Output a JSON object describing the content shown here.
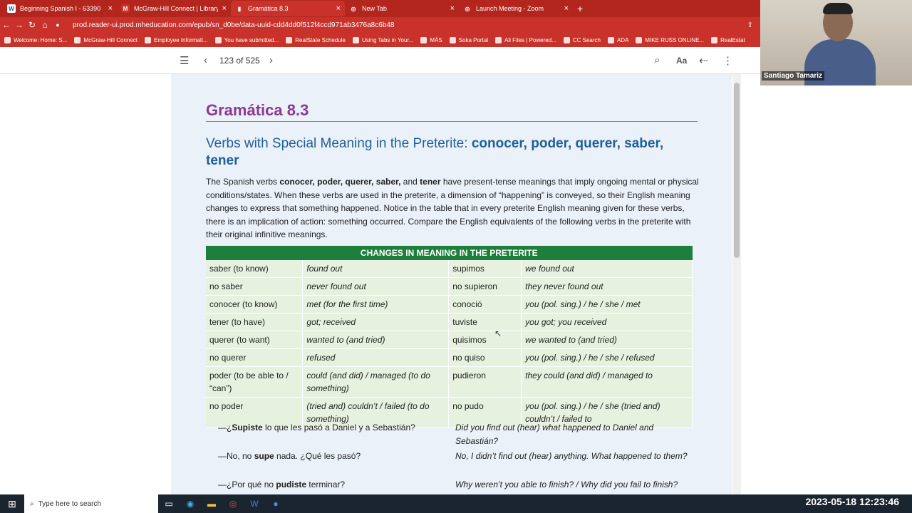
{
  "browser": {
    "tabs": [
      {
        "label": "Beginning Spanish I - 63390",
        "fav": "W"
      },
      {
        "label": "McGraw-Hill Connect | Library H...",
        "fav": "M"
      },
      {
        "label": "Gramática 8.3",
        "fav": "▮"
      },
      {
        "label": "New Tab",
        "fav": "◎"
      },
      {
        "label": "Launch Meeting - Zoom",
        "fav": "◎"
      }
    ],
    "url": "prod.reader-ui.prod.mheducation.com/epub/sn_d0be/data-uuid-cdd4dd0f512f4ccd971ab3476a8c6b48",
    "bookmarks": [
      "Welcome: Home: S...",
      "McGraw-Hill Connect",
      "Employee Informati...",
      "You have submitted...",
      "RealState Schedule",
      "Using Tabs in Your...",
      "MÁS",
      "Soka Portal",
      "All Files | Powered...",
      "CC Search",
      "ADA",
      "MIKE RUSS ONLINE...",
      "RealEstat"
    ]
  },
  "reader": {
    "page_indicator": "123 of 525"
  },
  "content": {
    "heading": "Gramática 8.3",
    "subheading_plain": "Verbs with Special Meaning in the Preterite: ",
    "subheading_bold": "conocer, poder, querer, saber, tener",
    "para_1": "The Spanish verbs ",
    "para_b1": "conocer, poder, querer, saber,",
    "para_2": " and ",
    "para_b2": "tener",
    "para_3": " have present-tense meanings that imply ongoing mental or physical conditions/states. When these verbs are used in the preterite, a dimension of “happening” is conveyed, so their English meaning changes to express that something happened. Notice in the table that in every preterite English meaning given for these verbs, there is an implication of action: something occurred. Compare the English equivalents of the following verbs in the preterite with their original infinitive meanings.",
    "table_title": "CHANGES IN MEANING IN THE PRETERITE",
    "rows": [
      [
        "saber (to know)",
        "found out",
        "supimos",
        "we found out"
      ],
      [
        "no saber",
        "never found out",
        "no supieron",
        "they never found out"
      ],
      [
        "conocer (to know)",
        "met (for the first time)",
        "conoció",
        "you (pol. sing.) / he / she / met"
      ],
      [
        "tener (to have)",
        "got; received",
        "tuviste",
        "you got; you received"
      ],
      [
        "querer (to want)",
        "wanted to (and tried)",
        "quisimos",
        "we wanted to (and tried)"
      ],
      [
        "no querer",
        "refused",
        "no quiso",
        "you (pol. sing.) / he / she / refused"
      ],
      [
        "poder (to be able to / “can”)",
        "could (and did) / managed (to do something)",
        "pudieron",
        "they could (and did) / managed to"
      ],
      [
        "no poder",
        "(tried and) couldn’t / failed (to do something)",
        "no pudo",
        "you (pol. sing.) / he / she (tried and) couldn’t / failed to"
      ]
    ],
    "dialog": [
      {
        "sp_a": "—¿",
        "sp_b": "Supiste",
        "sp_c": " lo que les pasó a Daniel y a Sebastián?",
        "en": "Did you find out (hear) what happened to Daniel and Sebastián?"
      },
      {
        "sp_a": "—No, no ",
        "sp_b": "supe",
        "sp_c": " nada. ¿Qué les pasó?",
        "en": "No, I didn’t find out (hear) anything. What happened to them?"
      },
      {
        "sp_a": "—¿Por qué no ",
        "sp_b": "pudiste",
        "sp_c": " terminar?",
        "en": "Why weren’t you able to finish? / Why did you fail to finish?"
      }
    ]
  },
  "zoom": {
    "participant": "Santiago Tamariz"
  },
  "taskbar": {
    "search_placeholder": "Type here to search",
    "datetime": "2023-05-18  12:23:46"
  },
  "icons": {
    "search": "search-icon",
    "font": "Aa",
    "back": "↩"
  }
}
